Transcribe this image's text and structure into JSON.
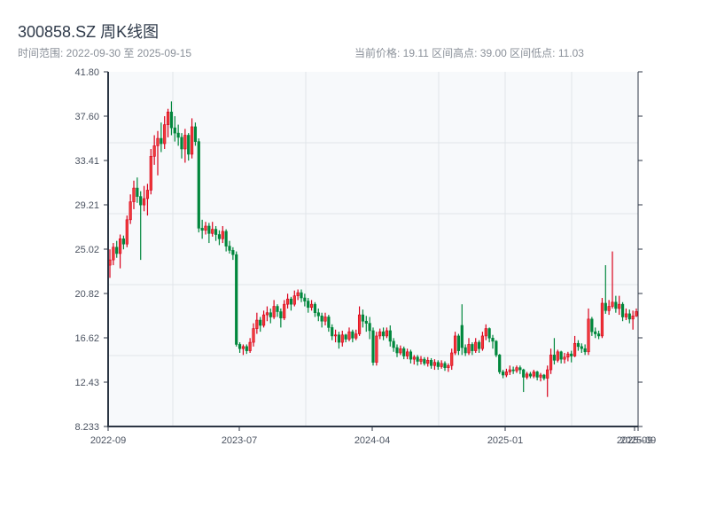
{
  "header": {
    "title": "300858.SZ 周K线图",
    "range_text": "时间范围: 2022-09-30 至 2025-09-15",
    "stats_text": "当前价格: 19.11  区间高点: 39.00  区间低点: 11.03"
  },
  "chart_data": {
    "type": "candlestick",
    "title": "300858.SZ 周K线图",
    "value_order": [
      "open",
      "close",
      "low",
      "high"
    ],
    "ylim": [
      8.233,
      41.8
    ],
    "y_ticks": [
      "41.80",
      "37.60",
      "33.41",
      "29.21",
      "25.02",
      "20.82",
      "16.62",
      "12.43",
      "8.233"
    ],
    "x_ticks": [
      "2022-09",
      "2023-07",
      "2024-04",
      "2025-01",
      "2025-09",
      "2025-09"
    ],
    "grid": true,
    "colors": {
      "up": "#d9001b",
      "up_fill": "#f03a3a",
      "down": "#00873c",
      "axis": "#2c3644",
      "grid": "#e1e5ea",
      "plot_bg": "#f7f9fb"
    },
    "dates": [
      "2022-09-30",
      "2022-10-07",
      "2022-10-14",
      "2022-10-21",
      "2022-10-28",
      "2022-11-04",
      "2022-11-11",
      "2022-11-18",
      "2022-11-25",
      "2022-12-02",
      "2022-12-09",
      "2022-12-16",
      "2022-12-23",
      "2022-12-30",
      "2023-01-06",
      "2023-01-13",
      "2023-01-20",
      "2023-01-27",
      "2023-02-03",
      "2023-02-10",
      "2023-02-17",
      "2023-02-24",
      "2023-03-03",
      "2023-03-10",
      "2023-03-17",
      "2023-03-24",
      "2023-03-31",
      "2023-04-07",
      "2023-04-14",
      "2023-04-21",
      "2023-04-28",
      "2023-05-05",
      "2023-05-12",
      "2023-05-19",
      "2023-05-26",
      "2023-06-02",
      "2023-06-09",
      "2023-06-16",
      "2023-06-23",
      "2023-06-30",
      "2023-07-07",
      "2023-07-14",
      "2023-07-21",
      "2023-07-28",
      "2023-08-04",
      "2023-08-11",
      "2023-08-18",
      "2023-08-25",
      "2023-09-01",
      "2023-09-08",
      "2023-09-15",
      "2023-09-22",
      "2023-09-29",
      "2023-10-06",
      "2023-10-13",
      "2023-10-20",
      "2023-10-27",
      "2023-11-03",
      "2023-11-10",
      "2023-11-17",
      "2023-11-24",
      "2023-12-01",
      "2023-12-08",
      "2023-12-15",
      "2023-12-22",
      "2023-12-29",
      "2024-01-05",
      "2024-01-12",
      "2024-01-19",
      "2024-01-26",
      "2024-02-02",
      "2024-02-09",
      "2024-02-16",
      "2024-02-23",
      "2024-03-01",
      "2024-03-08",
      "2024-03-15",
      "2024-03-22",
      "2024-03-29",
      "2024-04-05",
      "2024-04-12",
      "2024-04-19",
      "2024-04-26",
      "2024-05-03",
      "2024-05-10",
      "2024-05-17",
      "2024-05-24",
      "2024-05-31",
      "2024-06-07",
      "2024-06-14",
      "2024-06-21",
      "2024-06-28",
      "2024-07-05",
      "2024-07-12",
      "2024-07-19",
      "2024-07-26",
      "2024-08-02",
      "2024-08-09",
      "2024-08-16",
      "2024-08-23",
      "2024-08-30",
      "2024-09-06",
      "2024-09-13",
      "2024-09-20",
      "2024-09-27",
      "2024-10-04",
      "2024-10-11",
      "2024-10-18",
      "2024-10-25",
      "2024-11-01",
      "2024-11-08",
      "2024-11-15",
      "2024-11-22",
      "2024-11-29",
      "2024-12-06",
      "2024-12-13",
      "2024-12-20",
      "2024-12-27",
      "2025-01-03",
      "2025-01-10",
      "2025-01-17",
      "2025-01-24",
      "2025-01-31",
      "2025-02-07",
      "2025-02-14",
      "2025-02-21",
      "2025-02-28",
      "2025-03-07",
      "2025-03-14",
      "2025-03-21",
      "2025-03-28",
      "2025-04-04",
      "2025-04-11",
      "2025-04-18",
      "2025-04-25",
      "2025-05-02",
      "2025-05-09",
      "2025-05-16",
      "2025-05-23",
      "2025-05-30",
      "2025-06-06",
      "2025-06-13",
      "2025-06-20",
      "2025-06-27",
      "2025-07-04",
      "2025-07-11",
      "2025-07-18",
      "2025-07-25",
      "2025-08-01",
      "2025-08-08",
      "2025-08-15",
      "2025-08-22",
      "2025-08-29",
      "2025-09-05",
      "2025-09-12",
      "2025-09-15"
    ],
    "ohlc": [
      [
        23.5,
        24.0,
        22.3,
        25.0
      ],
      [
        24.0,
        25.2,
        23.5,
        25.6
      ],
      [
        25.2,
        24.6,
        24.2,
        25.8
      ],
      [
        24.6,
        26.0,
        23.2,
        26.4
      ],
      [
        26.0,
        25.5,
        25.0,
        26.3
      ],
      [
        25.5,
        27.8,
        25.2,
        28.2
      ],
      [
        27.8,
        29.5,
        27.4,
        30.2
      ],
      [
        29.5,
        30.8,
        28.8,
        31.5
      ],
      [
        30.8,
        30.0,
        29.4,
        31.8
      ],
      [
        30.0,
        29.2,
        24.0,
        30.5
      ],
      [
        29.2,
        29.8,
        28.6,
        31.0
      ],
      [
        29.8,
        30.6,
        28.2,
        31.2
      ],
      [
        30.6,
        33.8,
        30.2,
        34.5
      ],
      [
        33.8,
        34.8,
        33.0,
        35.8
      ],
      [
        34.8,
        35.5,
        32.0,
        36.2
      ],
      [
        35.5,
        35.0,
        34.2,
        37.0
      ],
      [
        35.0,
        36.8,
        34.5,
        37.6
      ],
      [
        36.8,
        38.0,
        35.6,
        38.3
      ],
      [
        38.0,
        36.5,
        35.8,
        39.0
      ],
      [
        36.5,
        36.0,
        35.2,
        37.6
      ],
      [
        36.0,
        35.6,
        34.8,
        36.8
      ],
      [
        35.6,
        34.5,
        33.6,
        36.0
      ],
      [
        34.5,
        35.8,
        33.2,
        36.4
      ],
      [
        35.8,
        34.0,
        33.4,
        36.0
      ],
      [
        34.0,
        36.6,
        33.6,
        37.4
      ],
      [
        36.6,
        35.2,
        34.8,
        37.0
      ],
      [
        35.2,
        27.0,
        26.6,
        35.5
      ],
      [
        27.0,
        26.8,
        26.0,
        27.8
      ],
      [
        26.8,
        27.2,
        26.4,
        27.6
      ],
      [
        27.2,
        26.5,
        25.6,
        27.5
      ],
      [
        26.5,
        26.9,
        26.2,
        27.6
      ],
      [
        26.9,
        26.4,
        25.8,
        27.2
      ],
      [
        26.4,
        26.0,
        25.4,
        26.8
      ],
      [
        26.0,
        26.7,
        25.6,
        27.2
      ],
      [
        26.7,
        25.3,
        24.8,
        26.9
      ],
      [
        25.3,
        24.9,
        24.6,
        25.8
      ],
      [
        24.9,
        24.5,
        24.0,
        25.2
      ],
      [
        24.5,
        16.0,
        15.8,
        24.8
      ],
      [
        16.0,
        15.6,
        15.2,
        16.2
      ],
      [
        15.6,
        15.8,
        15.0,
        16.0
      ],
      [
        15.8,
        15.4,
        15.1,
        16.0
      ],
      [
        15.4,
        16.2,
        15.2,
        16.6
      ],
      [
        16.2,
        17.5,
        15.8,
        18.0
      ],
      [
        17.5,
        18.3,
        17.0,
        19.0
      ],
      [
        18.3,
        17.8,
        17.2,
        18.6
      ],
      [
        17.8,
        18.8,
        17.6,
        19.2
      ],
      [
        18.8,
        19.0,
        18.2,
        19.6
      ],
      [
        19.0,
        18.6,
        18.0,
        19.4
      ],
      [
        18.6,
        19.6,
        18.4,
        20.2
      ],
      [
        19.6,
        19.1,
        18.6,
        19.8
      ],
      [
        19.1,
        18.5,
        17.6,
        19.4
      ],
      [
        18.5,
        19.8,
        18.3,
        20.2
      ],
      [
        19.8,
        20.3,
        19.4,
        20.8
      ],
      [
        20.3,
        19.8,
        19.2,
        20.5
      ],
      [
        19.8,
        20.6,
        19.6,
        21.1
      ],
      [
        20.6,
        20.9,
        20.2,
        21.2
      ],
      [
        20.9,
        20.4,
        20.0,
        21.2
      ],
      [
        20.4,
        20.1,
        19.6,
        20.8
      ],
      [
        20.1,
        19.5,
        19.0,
        20.4
      ],
      [
        19.5,
        19.8,
        19.2,
        20.2
      ],
      [
        19.8,
        19.0,
        18.6,
        20.0
      ],
      [
        19.0,
        18.7,
        18.2,
        19.4
      ],
      [
        18.7,
        18.2,
        17.6,
        19.0
      ],
      [
        18.2,
        18.6,
        17.8,
        19.0
      ],
      [
        18.6,
        17.6,
        17.2,
        18.8
      ],
      [
        17.6,
        16.8,
        16.4,
        17.9
      ],
      [
        16.8,
        16.9,
        16.2,
        17.4
      ],
      [
        16.9,
        16.2,
        15.6,
        17.2
      ],
      [
        16.2,
        16.9,
        15.8,
        17.3
      ],
      [
        16.9,
        16.5,
        16.2,
        17.0
      ],
      [
        16.5,
        17.2,
        16.3,
        17.6
      ],
      [
        17.2,
        16.6,
        16.2,
        17.4
      ],
      [
        16.6,
        17.0,
        16.4,
        17.4
      ],
      [
        17.0,
        18.8,
        16.8,
        19.6
      ],
      [
        18.8,
        18.2,
        17.6,
        19.3
      ],
      [
        18.2,
        18.0,
        17.2,
        18.7
      ],
      [
        18.0,
        17.3,
        16.5,
        18.6
      ],
      [
        17.3,
        14.3,
        14.0,
        17.6
      ],
      [
        14.3,
        16.8,
        14.0,
        17.2
      ],
      [
        16.8,
        17.2,
        16.5,
        17.5
      ],
      [
        17.2,
        16.8,
        16.4,
        17.6
      ],
      [
        16.8,
        17.3,
        16.6,
        17.6
      ],
      [
        17.3,
        16.3,
        15.8,
        17.8
      ],
      [
        16.3,
        15.7,
        15.3,
        16.6
      ],
      [
        15.7,
        15.2,
        14.8,
        16.0
      ],
      [
        15.2,
        15.6,
        15.0,
        15.9
      ],
      [
        15.6,
        14.9,
        14.6,
        15.8
      ],
      [
        14.9,
        15.3,
        14.6,
        15.6
      ],
      [
        15.3,
        14.6,
        14.2,
        15.5
      ],
      [
        14.6,
        14.8,
        14.1,
        15.0
      ],
      [
        14.8,
        14.4,
        14.0,
        15.0
      ],
      [
        14.4,
        14.6,
        14.1,
        14.9
      ],
      [
        14.6,
        14.2,
        14.0,
        14.8
      ],
      [
        14.2,
        14.5,
        13.9,
        14.8
      ],
      [
        14.5,
        14.0,
        13.7,
        14.7
      ],
      [
        14.0,
        14.3,
        13.6,
        14.6
      ],
      [
        14.3,
        13.9,
        13.6,
        14.5
      ],
      [
        13.9,
        14.2,
        13.7,
        14.5
      ],
      [
        14.2,
        13.8,
        13.5,
        14.4
      ],
      [
        13.8,
        14.0,
        13.4,
        14.2
      ],
      [
        14.0,
        15.2,
        13.6,
        15.6
      ],
      [
        15.2,
        16.8,
        15.0,
        17.2
      ],
      [
        16.8,
        15.4,
        15.0,
        17.0
      ],
      [
        17.8,
        15.7,
        15.0,
        19.8
      ],
      [
        15.7,
        15.2,
        14.9,
        16.0
      ],
      [
        15.2,
        16.0,
        15.0,
        16.6
      ],
      [
        16.0,
        15.4,
        15.0,
        16.2
      ],
      [
        15.4,
        16.2,
        15.2,
        16.6
      ],
      [
        16.2,
        15.6,
        15.2,
        16.4
      ],
      [
        15.6,
        16.8,
        15.4,
        17.2
      ],
      [
        16.8,
        17.5,
        16.4,
        17.9
      ],
      [
        17.5,
        16.6,
        16.2,
        17.6
      ],
      [
        16.6,
        16.3,
        15.6,
        16.9
      ],
      [
        16.3,
        15.0,
        14.8,
        16.4
      ],
      [
        15.0,
        13.4,
        13.2,
        15.1
      ],
      [
        13.4,
        13.1,
        12.8,
        13.6
      ],
      [
        13.1,
        13.4,
        12.9,
        13.7
      ],
      [
        13.4,
        13.6,
        13.1,
        14.0
      ],
      [
        13.6,
        13.5,
        13.2,
        13.9
      ],
      [
        13.5,
        13.8,
        13.3,
        14.0
      ],
      [
        13.8,
        13.6,
        13.2,
        14.0
      ],
      [
        13.6,
        12.9,
        11.5,
        13.7
      ],
      [
        12.9,
        13.2,
        12.7,
        13.4
      ],
      [
        13.2,
        13.0,
        12.8,
        13.4
      ],
      [
        13.0,
        13.4,
        12.8,
        13.6
      ],
      [
        13.4,
        12.9,
        12.6,
        13.5
      ],
      [
        12.9,
        13.1,
        12.5,
        13.3
      ],
      [
        13.1,
        12.8,
        12.6,
        13.2
      ],
      [
        12.8,
        13.6,
        11.03,
        14.0
      ],
      [
        13.6,
        15.0,
        13.2,
        15.6
      ],
      [
        15.0,
        14.5,
        14.1,
        16.6
      ],
      [
        14.5,
        15.3,
        14.3,
        15.5
      ],
      [
        15.3,
        14.6,
        14.2,
        15.4
      ],
      [
        14.6,
        14.8,
        14.2,
        15.2
      ],
      [
        14.8,
        15.1,
        14.4,
        15.3
      ],
      [
        15.1,
        14.9,
        14.3,
        15.4
      ],
      [
        14.9,
        16.1,
        14.8,
        16.8
      ],
      [
        16.1,
        15.8,
        15.4,
        16.4
      ],
      [
        15.8,
        15.6,
        15.2,
        16.1
      ],
      [
        15.6,
        15.3,
        15.0,
        16.0
      ],
      [
        15.3,
        18.4,
        15.0,
        19.4
      ],
      [
        18.4,
        17.2,
        16.8,
        18.6
      ],
      [
        17.2,
        17.0,
        16.6,
        17.6
      ],
      [
        17.0,
        16.8,
        16.5,
        17.3
      ],
      [
        16.8,
        19.9,
        16.6,
        20.4
      ],
      [
        19.9,
        19.2,
        18.9,
        23.5
      ],
      [
        19.2,
        19.6,
        18.8,
        20.2
      ],
      [
        19.6,
        20.0,
        19.4,
        24.8
      ],
      [
        20.0,
        19.4,
        19.0,
        20.6
      ],
      [
        19.4,
        19.8,
        18.8,
        20.6
      ],
      [
        19.8,
        18.6,
        18.2,
        20.0
      ],
      [
        18.6,
        18.9,
        18.3,
        19.4
      ],
      [
        18.9,
        18.4,
        18.0,
        19.3
      ],
      [
        18.4,
        18.7,
        17.4,
        19.2
      ],
      [
        18.7,
        19.11,
        18.6,
        19.4
      ]
    ]
  }
}
